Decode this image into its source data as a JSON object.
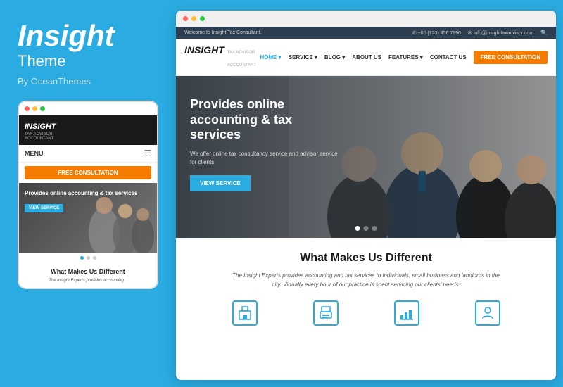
{
  "brand": {
    "title": "Insight",
    "subtitle": "Theme",
    "author": "By OceanThemes"
  },
  "mobile": {
    "logo": "INSIGHT",
    "logo_sub1": "TAX ADVISOR",
    "logo_sub2": "ACCOUNTANT",
    "menu_label": "MENU",
    "cta_button": "FREE CONSULTATION",
    "hero_heading": "Provides online accounting & tax services",
    "view_service": "VIEW SERVICE",
    "section_title": "What Makes Us Different",
    "section_text": "The Insight Experts provides accounting..."
  },
  "desktop": {
    "top_info_left": "Welcome to Insight Tax Consultant.",
    "top_info_phone": "✆ +00 (123) 456 7890",
    "top_info_email": "✉ info@insighttaxadvisor.com",
    "logo": "INSIGHT",
    "logo_sub1": "TAX ADVISOR",
    "logo_sub2": "ACCOUNTANT",
    "nav_links": [
      "HOME",
      "SERVICE",
      "BLOG",
      "ABOUT US",
      "FEATURES",
      "CONTACT US"
    ],
    "cta_button": "FREE CONSULTATION",
    "hero_heading": "Provides online accounting & tax services",
    "hero_subtext": "We offer online tax consultancy service and advisor service for clients",
    "view_service_btn": "VIEW SERVICE",
    "section_title": "What Makes Us Different",
    "section_text": "The Insight Experts provides accounting and tax services to individuals, small business and landlords in the city. Virtually every hour of our practice is spent servicing our clients' needs.",
    "feature_icons": [
      "🏦",
      "🖨",
      "📊",
      "👤"
    ]
  },
  "colors": {
    "primary_blue": "#2AACE2",
    "orange": "#F57C00",
    "dark": "#1a1a1a"
  }
}
